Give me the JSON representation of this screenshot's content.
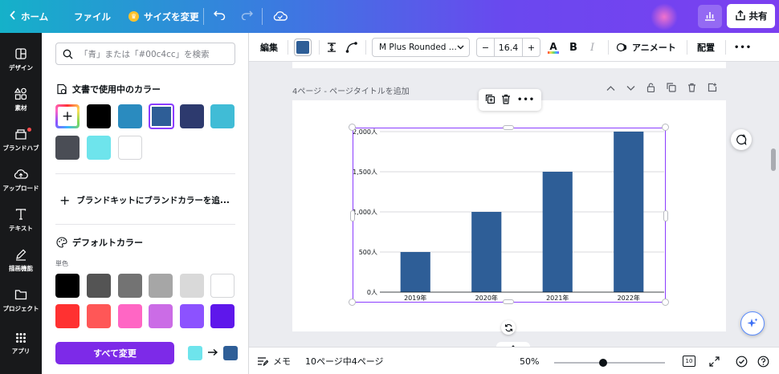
{
  "topbar": {
    "home_label": "ホーム",
    "file_label": "ファイル",
    "resize_label": "サイズを変更",
    "share_label": "共有"
  },
  "rail": {
    "items": [
      {
        "label": "デザイン",
        "icon": "layout-icon"
      },
      {
        "label": "素材",
        "icon": "shapes-icon"
      },
      {
        "label": "ブランドハブ",
        "icon": "brand-icon"
      },
      {
        "label": "アップロード",
        "icon": "cloud-upload-icon"
      },
      {
        "label": "テキスト",
        "icon": "text-icon"
      },
      {
        "label": "描画機能",
        "icon": "draw-icon"
      },
      {
        "label": "プロジェクト",
        "icon": "folder-icon"
      },
      {
        "label": "アプリ",
        "icon": "apps-icon"
      }
    ]
  },
  "panel": {
    "search_placeholder": "「青」または「#00c4cc」を検索",
    "doc_colors_title": "文書で使用中のカラー",
    "doc_colors": [
      "#000000",
      "#2a8bbf",
      "#2e5e97",
      "#2d3a6e",
      "#40bcd6",
      "#4a4d55",
      "#6ee4ec",
      "#ffffff"
    ],
    "brand_add_label": "ブランドキットにブランドカラーを追...",
    "default_colors_title": "デフォルトカラー",
    "mono_label": "単色",
    "default_row1": [
      "#000000",
      "#545454",
      "#737373",
      "#a6a6a6",
      "#d9d9d9",
      "#ffffff"
    ],
    "default_row2": [
      "#ff3131",
      "#ff5757",
      "#ff66c4",
      "#cb6ce6",
      "#8c52ff",
      "#5e17eb"
    ],
    "change_all_label": "すべて変更",
    "from_color": "#6ee4ec",
    "to_color": "#2e5e97"
  },
  "toolbar": {
    "edit_label": "編集",
    "font_name": "M Plus Rounded ...",
    "font_size": "16.4",
    "minus": "−",
    "plus": "+",
    "bold": "B",
    "italic": "I",
    "animate_label": "アニメート",
    "position_label": "配置",
    "more": "•••",
    "fill_color": "#2e5e97"
  },
  "canvas": {
    "page_label": "4ページ - ページタイトルを追加"
  },
  "chart_data": {
    "type": "bar",
    "categories": [
      "2019年",
      "2020年",
      "2021年",
      "2022年"
    ],
    "values": [
      500,
      1000,
      1500,
      2000
    ],
    "yticks": [
      "0人",
      "500人",
      "1,000人",
      "1,500人",
      "2,000人"
    ],
    "ylim": [
      0,
      2000
    ],
    "color": "#2e5e97",
    "grid": true,
    "title": "",
    "xlabel": "",
    "ylabel": ""
  },
  "bottombar": {
    "notes_label": "メモ",
    "page_count_label": "10ページ中4ページ",
    "zoom_label": "50%",
    "grid_count": "10"
  }
}
